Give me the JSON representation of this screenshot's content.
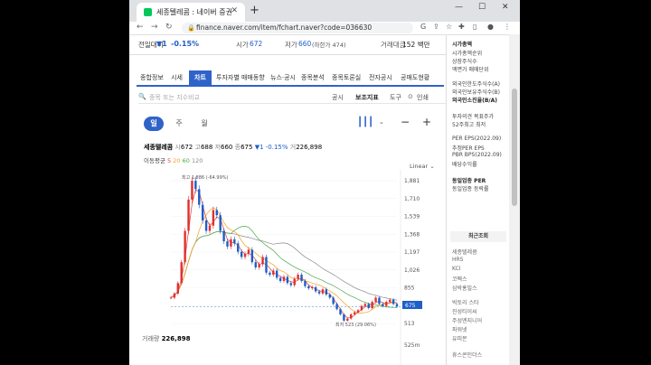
{
  "browser": {
    "tab_title": "세종텔레콤 : 네이버 증권",
    "url": "finance.naver.com/item/fchart.naver?code=036630",
    "new_tab": "+",
    "minimize": "—",
    "maximize": "☐",
    "close": "✕"
  },
  "header": {
    "prev_label": "전일대비",
    "change": "▼1",
    "change_pct": "-0.15%",
    "open_label": "시가",
    "open_val": "672",
    "low_label": "저가",
    "low_val": "660",
    "lowlimit": "(하한가 474)",
    "amount_label": "거래대금",
    "amount_val": "152 백만"
  },
  "tabs": [
    "종합정보",
    "시세",
    "차트",
    "투자자별 매매동향",
    "뉴스·공시",
    "종목분석",
    "종목토론실",
    "전자공시",
    "공매도현황"
  ],
  "active_tab": "차트",
  "toolbar": {
    "search_placeholder": "종목 또는 지수비교",
    "notice": "공시",
    "indicator": "보조지표",
    "tools": "도구",
    "print": "인쇄"
  },
  "periods": [
    "일",
    "주",
    "월"
  ],
  "active_period": "일",
  "chart_info": {
    "name": "세종텔레콤",
    "open_l": "시",
    "open_v": "672",
    "high_l": "고",
    "high_v": "688",
    "low_l": "저",
    "low_v": "660",
    "close_l": "종",
    "close_v": "675",
    "chg": "▼1 -0.15%",
    "vol_l": "거",
    "vol_v": "226,898",
    "ma_label": "이동평균",
    "ma_5": "5",
    "ma_20": "20",
    "ma_60": "60",
    "ma_120": "120",
    "scale": "Linear",
    "max_note": "최고 1,886 (-64.99%)",
    "min_note": "최저 523 (29.06%)",
    "volume_label": "거래량",
    "volume_value": "226,898",
    "volume_axis": "525m",
    "current_tag": "675"
  },
  "chart_data": {
    "type": "line",
    "y_ticks": [
      "1,881",
      "1,710",
      "1,539",
      "1,368",
      "1,197",
      "1,026",
      "855",
      "684",
      "513"
    ],
    "ylim": [
      513,
      1881
    ],
    "current": 675,
    "close": [
      760,
      800,
      900,
      1100,
      1400,
      1700,
      1880,
      1800,
      1650,
      1500,
      1400,
      1450,
      1600,
      1550,
      1400,
      1300,
      1250,
      1320,
      1280,
      1200,
      1150,
      1180,
      1220,
      1100,
      1050,
      1080,
      1150,
      1000,
      980,
      1020,
      950,
      920,
      960,
      900,
      880,
      940,
      980,
      920,
      870,
      850,
      860,
      820,
      800,
      840,
      790,
      760,
      700,
      650,
      600,
      540,
      560,
      600,
      620,
      640,
      680,
      700,
      660,
      720,
      760,
      700,
      680,
      720,
      740,
      700,
      675
    ]
  },
  "right_panel": {
    "items": [
      "시가총액",
      "시가총액순위",
      "상장주식수",
      "액면가 매매단위",
      "외국인한도주식수(A)",
      "외국인보유주식수(B)",
      "외국인소진율(B/A)",
      "투자의견 목표주가",
      "52주최고 최저",
      "PER EPS(2022.09)",
      "추정PER EPS",
      "PBR BPS(2022.09)",
      "배당수익률",
      "동일업종 PER",
      "동일업종 등락률"
    ],
    "recent_title": "최근조회",
    "recent": [
      "세종텔레콤",
      "HRS",
      "KCI",
      "코팩스",
      "삼박홍빌스",
      "빅토리 스타",
      "진성티이씨",
      "주성엔지니어",
      "파워넷",
      "유피몬",
      "휴스콘인더스"
    ]
  },
  "colors": {
    "accent": "#2f63c9",
    "down": "#1e5ec8",
    "up": "#e03030",
    "ma5": "#e0413a",
    "ma20": "#f3a11d",
    "ma60": "#49a84a",
    "ma120": "#8a8a8a"
  }
}
